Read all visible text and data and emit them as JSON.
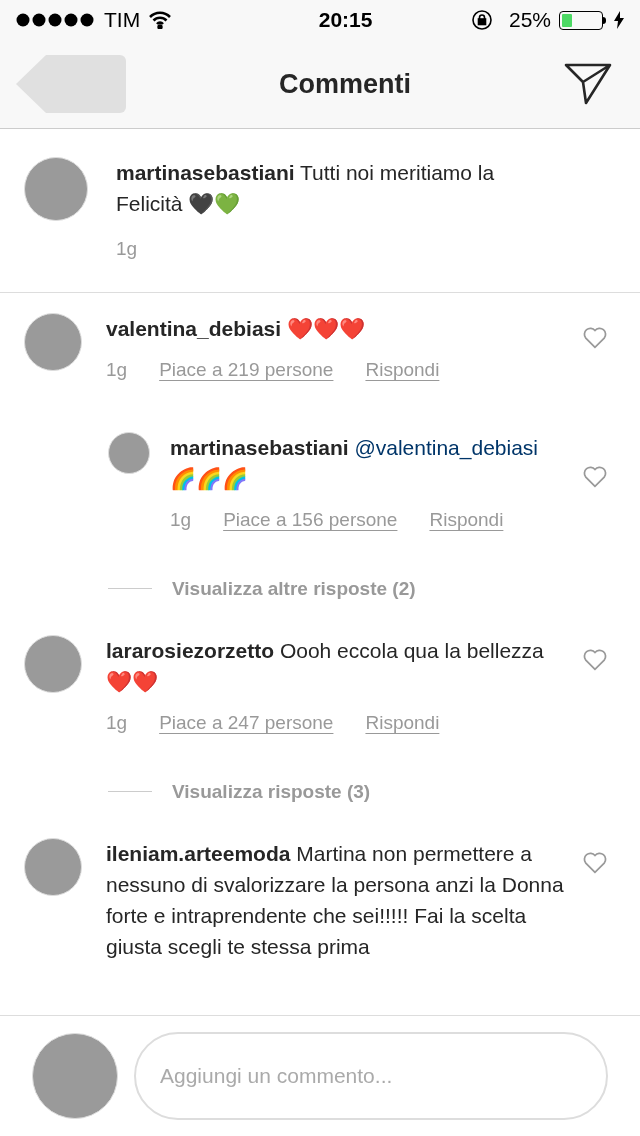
{
  "status_bar": {
    "carrier": "TIM",
    "time": "20:15",
    "battery": {
      "label": "25%",
      "level": 0.25
    }
  },
  "nav": {
    "title": "Commenti"
  },
  "caption": {
    "username": "martinasebastiani",
    "text": "Tutti noi meritiamo la Felicità 🖤💚",
    "time": "1g"
  },
  "thread": [
    {
      "kind": "comment",
      "username": "valentina_debiasi",
      "text": "❤️❤️❤️",
      "time": "1g",
      "likes": "Piace a 219 persone",
      "reply": "Rispondi",
      "replies": [
        {
          "username": "martinasebastiani",
          "mention": "@valentina_debiasi",
          "text": "🌈🌈🌈",
          "time": "1g",
          "likes": "Piace a 156 persone",
          "reply": "Rispondi"
        }
      ]
    },
    {
      "kind": "more_replies",
      "label": "Visualizza altre risposte (2)"
    },
    {
      "kind": "comment",
      "username": "lararosiezorzetto",
      "text": "Oooh eccola qua la bellezza ❤️❤️",
      "time": "1g",
      "likes": "Piace a 247 persone",
      "reply": "Rispondi"
    },
    {
      "kind": "more_replies",
      "label": "Visualizza risposte (3)"
    },
    {
      "kind": "comment",
      "username": "ileniam.arteemoda",
      "text": "Martina non permettere a nessuno di svalorizzare la persona anzi la Donna forte e intraprendente che sei!!!!! Fai la scelta giusta scegli te stessa prima"
    }
  ],
  "composer": {
    "placeholder": "Aggiungi un commento..."
  }
}
